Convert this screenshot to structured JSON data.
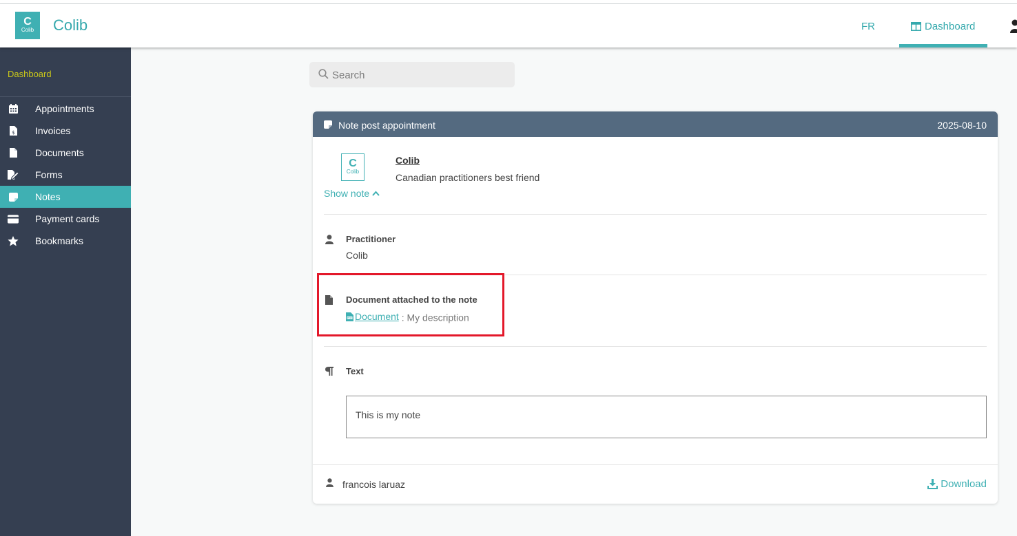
{
  "header": {
    "brand": "Colib",
    "logo_text": "Colib",
    "language": "FR",
    "dashboard_label": "Dashboard"
  },
  "sidebar": {
    "heading": "Dashboard",
    "items": [
      {
        "label": "Appointments",
        "icon": "calendar-icon",
        "active": false
      },
      {
        "label": "Invoices",
        "icon": "invoice-icon",
        "active": false
      },
      {
        "label": "Documents",
        "icon": "document-icon",
        "active": false
      },
      {
        "label": "Forms",
        "icon": "form-edit-icon",
        "active": false
      },
      {
        "label": "Notes",
        "icon": "note-icon",
        "active": true
      },
      {
        "label": "Payment cards",
        "icon": "credit-card-icon",
        "active": false
      },
      {
        "label": "Bookmarks",
        "icon": "star-icon",
        "active": false
      }
    ]
  },
  "search": {
    "placeholder": "Search",
    "value": ""
  },
  "note": {
    "title": "Note post appointment",
    "date": "2025-08-10",
    "org_name": "Colib",
    "org_logo_text": "Colib",
    "org_tagline": "Canadian practitioners best friend",
    "show_note_label": "Show note",
    "practitioner_label": "Practitioner",
    "practitioner_value": "Colib",
    "document_label": "Document attached to the note",
    "document_link": "Document",
    "document_separator": " : ",
    "document_description": "My description",
    "text_label": "Text",
    "text_value": "This is my note",
    "author": "francois laruaz",
    "download_label": "Download"
  },
  "colors": {
    "accent": "#3fb0b3",
    "sidebar_bg": "#353f51",
    "card_header_bg": "#546a80",
    "highlight": "#e3182a"
  }
}
